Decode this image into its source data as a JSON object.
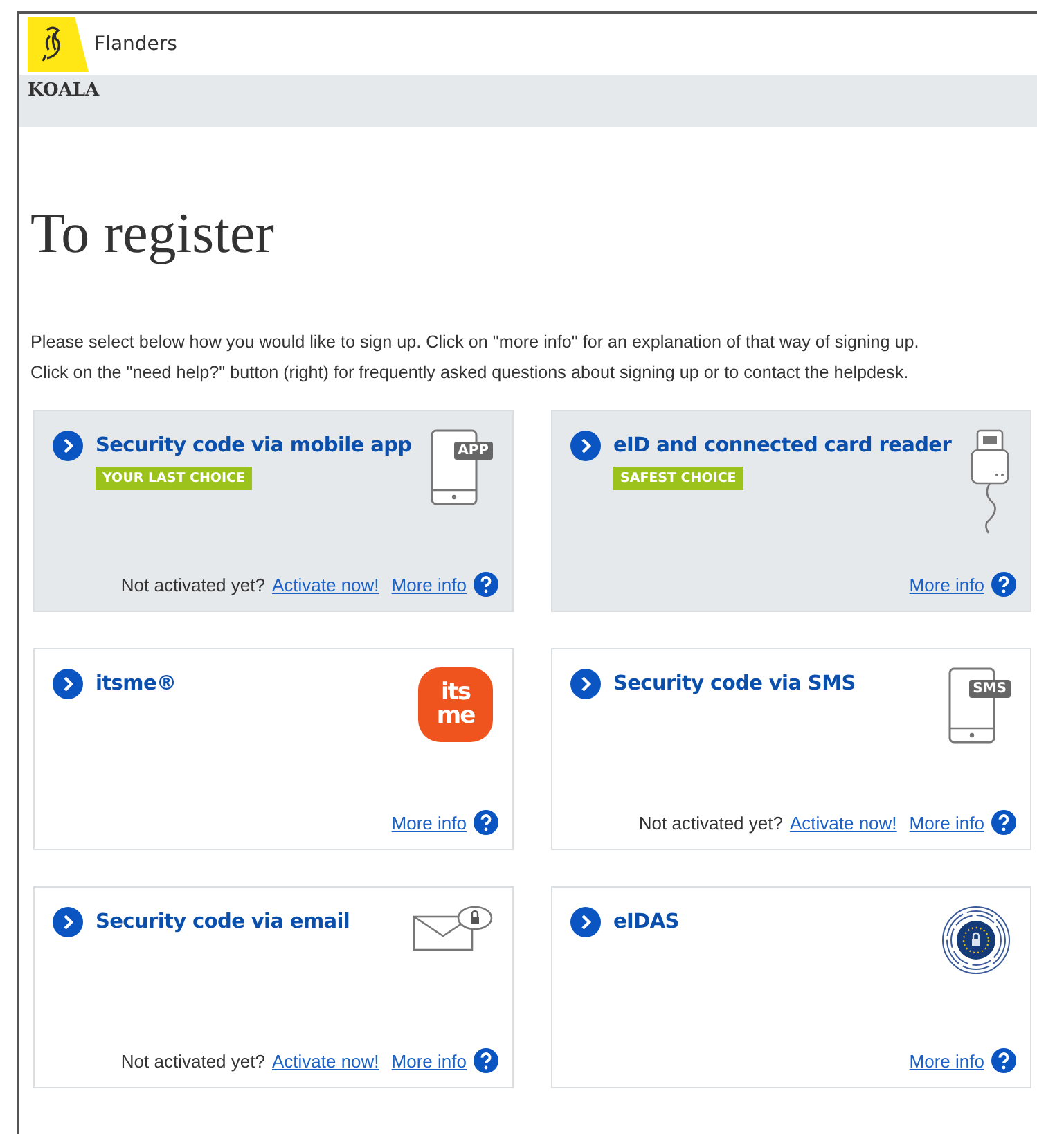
{
  "header": {
    "brand": "Flanders"
  },
  "app_bar": {
    "title": "KOALA"
  },
  "page": {
    "title": "To register",
    "intro": "Please select below how you would like to sign up. Click on \"more info\" for an explanation of that way of signing up. Click on the \"need help?\" button (right) for frequently asked questions about signing up or to contact the helpdesk."
  },
  "options": [
    {
      "title": "Security code via mobile app",
      "highlighted": true,
      "badge": "YOUR LAST CHOICE",
      "kind": "phone",
      "icon_text": "APP",
      "activate_prompt": "Not activated yet?",
      "activate_link": "Activate now!",
      "more_info": "More info"
    },
    {
      "title": "eID and connected card reader",
      "highlighted": true,
      "badge": "SAFEST CHOICE",
      "kind": "card-reader",
      "more_info": "More info"
    },
    {
      "title": "itsme®",
      "highlighted": false,
      "kind": "itsme",
      "icon_text": "its me",
      "more_info": "More info"
    },
    {
      "title": "Security code via SMS",
      "highlighted": false,
      "kind": "phone",
      "icon_text": "SMS",
      "activate_prompt": "Not activated yet?",
      "activate_link": "Activate now!",
      "more_info": "More info"
    },
    {
      "title": "Security code via email",
      "highlighted": false,
      "kind": "envelope",
      "activate_prompt": "Not activated yet?",
      "activate_link": "Activate now!",
      "more_info": "More info"
    },
    {
      "title": "eIDAS",
      "highlighted": false,
      "kind": "eidas",
      "more_info": "More info"
    }
  ]
}
